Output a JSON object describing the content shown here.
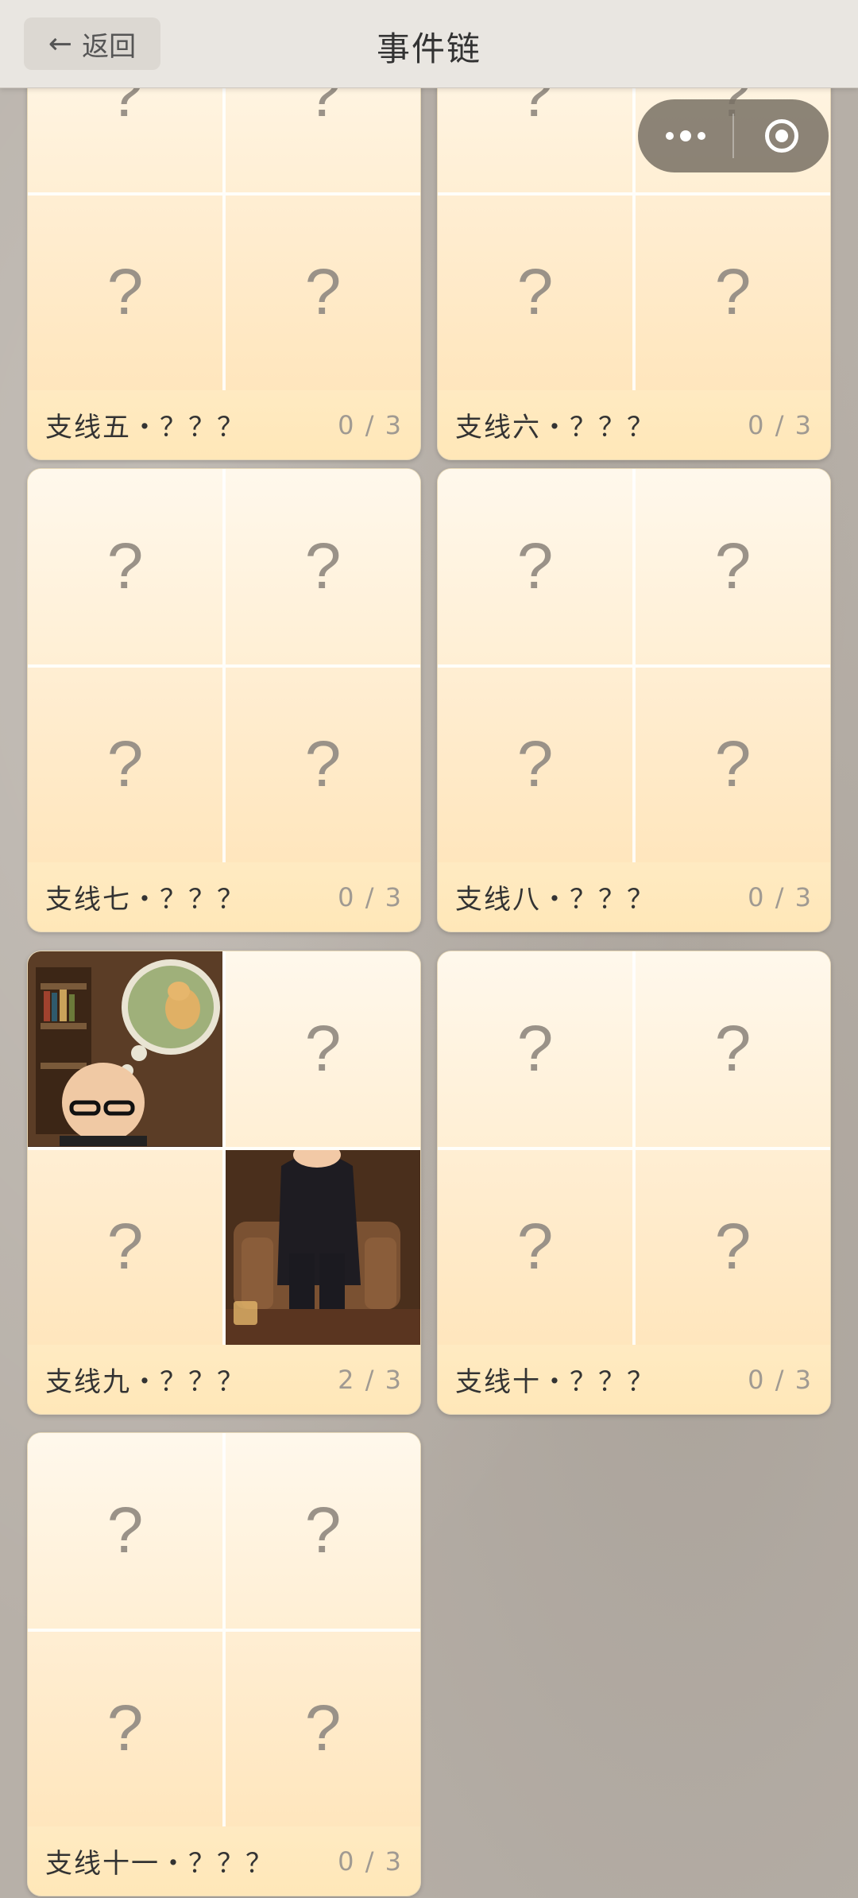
{
  "header": {
    "back_arrow": "←",
    "back_label": "返回",
    "title": "事件链"
  },
  "capsule": {
    "more_icon": "more-dots-icon",
    "close_icon": "target-circle-icon"
  },
  "cards": [
    {
      "title": "支线五・？？？",
      "count": "0 / 3",
      "cells": [
        "?",
        "?",
        "?",
        "?"
      ]
    },
    {
      "title": "支线六・？？？",
      "count": "0 / 3",
      "cells": [
        "?",
        "?",
        "?",
        "?"
      ]
    },
    {
      "title": "支线七・？？？",
      "count": "0 / 3",
      "cells": [
        "?",
        "?",
        "?",
        "?"
      ]
    },
    {
      "title": "支线八・？？？",
      "count": "0 / 3",
      "cells": [
        "?",
        "?",
        "?",
        "?"
      ]
    },
    {
      "title": "支线九・？？？",
      "count": "2 / 3",
      "cells": [
        "",
        "?",
        "?",
        ""
      ]
    },
    {
      "title": "支线十・？？？",
      "count": "0 / 3",
      "cells": [
        "?",
        "?",
        "?",
        "?"
      ]
    },
    {
      "title": "支线十一・？？？",
      "count": "0 / 3",
      "cells": [
        "?",
        "?",
        "?",
        "?"
      ]
    }
  ]
}
